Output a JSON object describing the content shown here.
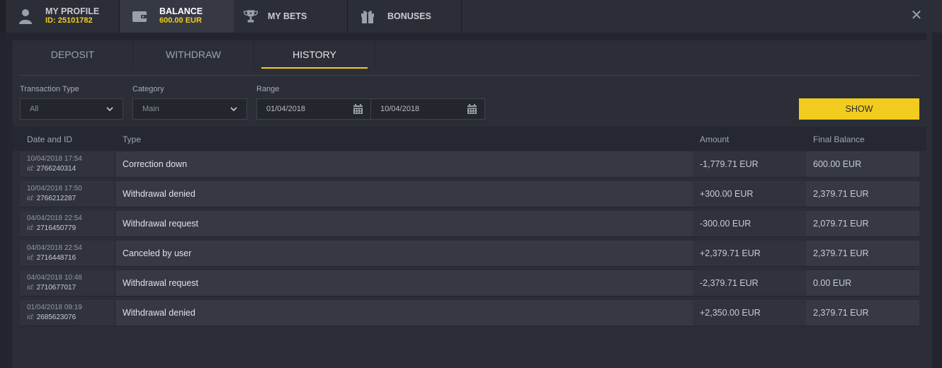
{
  "top_tabs": [
    {
      "label": "MY PROFILE",
      "sub": "ID: 25101782",
      "icon": "user-icon"
    },
    {
      "label": "BALANCE",
      "sub": "600.00 EUR",
      "icon": "wallet-icon"
    },
    {
      "label": "MY BETS",
      "sub": "",
      "icon": "trophy-icon"
    },
    {
      "label": "BONUSES",
      "sub": "",
      "icon": "gift-icon"
    }
  ],
  "close_icon": "close-icon",
  "sub_tabs": [
    "DEPOSIT",
    "WITHDRAW",
    "HISTORY"
  ],
  "active_sub_tab": "HISTORY",
  "filters": {
    "transaction_type_label": "Transaction Type",
    "transaction_type_value": "All",
    "category_label": "Category",
    "category_value": "Main",
    "range_label": "Range",
    "range_from": "01/04/2018",
    "range_to": "10/04/2018",
    "show_label": "SHOW"
  },
  "table": {
    "headers": {
      "date_id": "Date and ID",
      "type": "Type",
      "amount": "Amount",
      "final_balance": "Final Balance"
    },
    "id_prefix": "id:",
    "rows": [
      {
        "date": "10/04/2018 17:54",
        "id": "2766240314",
        "type": "Correction down",
        "amount": "-1,779.71 EUR",
        "balance": "600.00 EUR"
      },
      {
        "date": "10/04/2018 17:50",
        "id": "2766212287",
        "type": "Withdrawal denied",
        "amount": "+300.00 EUR",
        "balance": "2,379.71 EUR"
      },
      {
        "date": "04/04/2018 22:54",
        "id": "2716450779",
        "type": "Withdrawal request",
        "amount": "-300.00 EUR",
        "balance": "2,079.71 EUR"
      },
      {
        "date": "04/04/2018 22:54",
        "id": "2716448716",
        "type": "Canceled by user",
        "amount": "+2,379.71 EUR",
        "balance": "2,379.71 EUR"
      },
      {
        "date": "04/04/2018 10:48",
        "id": "2710677017",
        "type": "Withdrawal request",
        "amount": "-2,379.71 EUR",
        "balance": "0.00 EUR"
      },
      {
        "date": "01/04/2018 09:19",
        "id": "2685623076",
        "type": "Withdrawal denied",
        "amount": "+2,350.00 EUR",
        "balance": "2,379.71 EUR"
      }
    ]
  },
  "colors": {
    "accent": "#f2cb1f",
    "background": "#22252e",
    "panel": "#2b2e37",
    "row": "#363944"
  }
}
